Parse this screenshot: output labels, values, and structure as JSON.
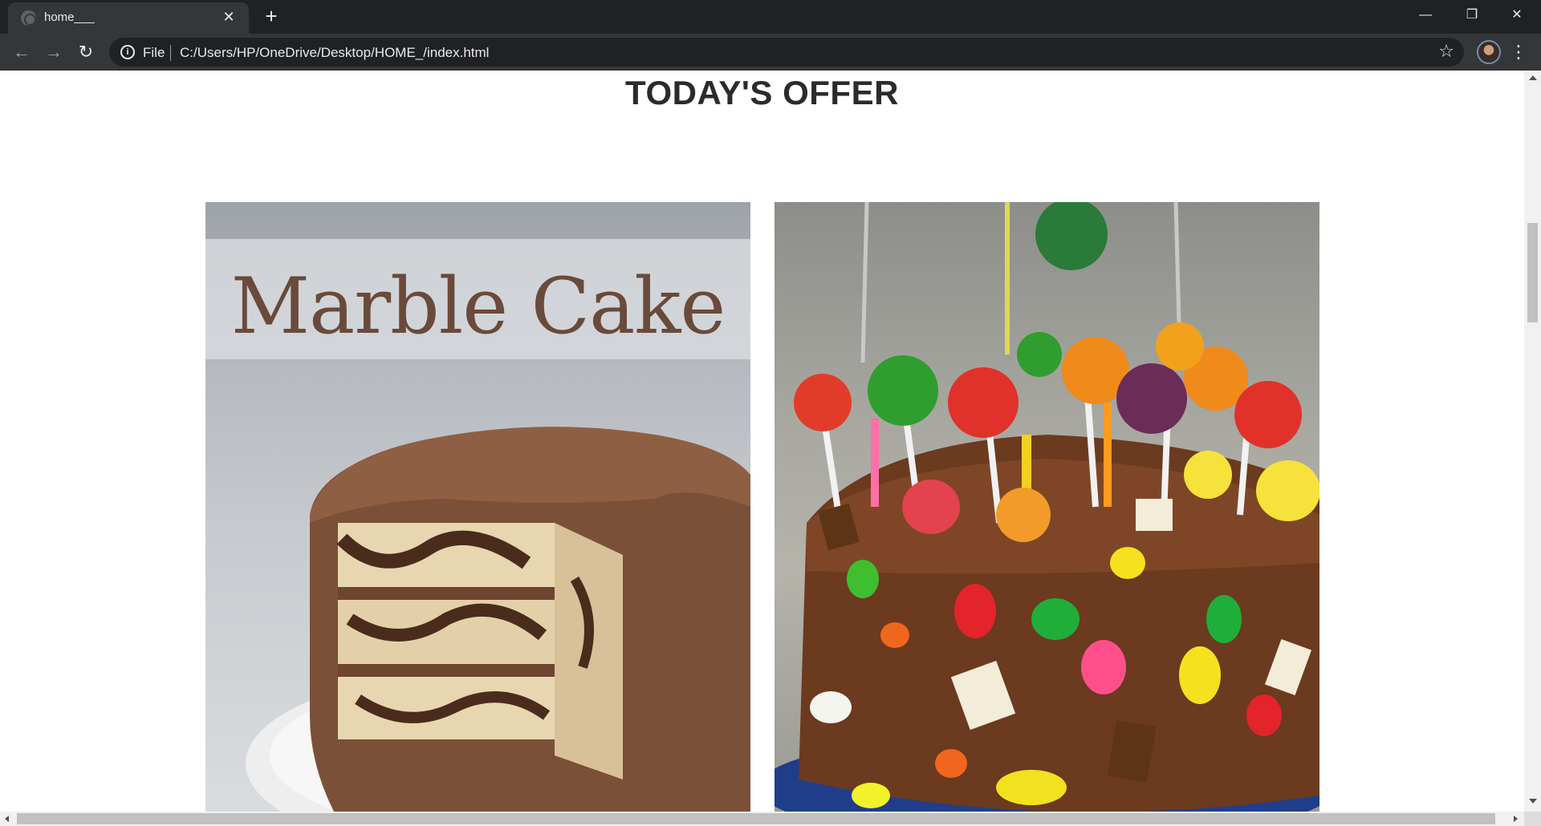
{
  "browser": {
    "tab_title": "home___",
    "tab_close": "✕",
    "new_tab": "+",
    "scheme_label": "File",
    "url": "C:/Users/HP/OneDrive/Desktop/HOME_/index.html",
    "info_icon": "i",
    "back_icon": "←",
    "forward_icon": "→",
    "reload_icon": "↻",
    "star_icon": "☆",
    "menu_icon": "⋮",
    "minimize_icon": "—",
    "restore_icon": "❐",
    "close_icon": "✕"
  },
  "page": {
    "heading": "TODAY'S OFFER",
    "offers": [
      {
        "caption": "Marble Cake"
      },
      {
        "caption": ""
      }
    ]
  },
  "colors": {
    "chrome_dark": "#202124",
    "chrome_tab": "#35363a",
    "heading": "#2b2b2b",
    "banner_text": "#6a4a3a"
  }
}
